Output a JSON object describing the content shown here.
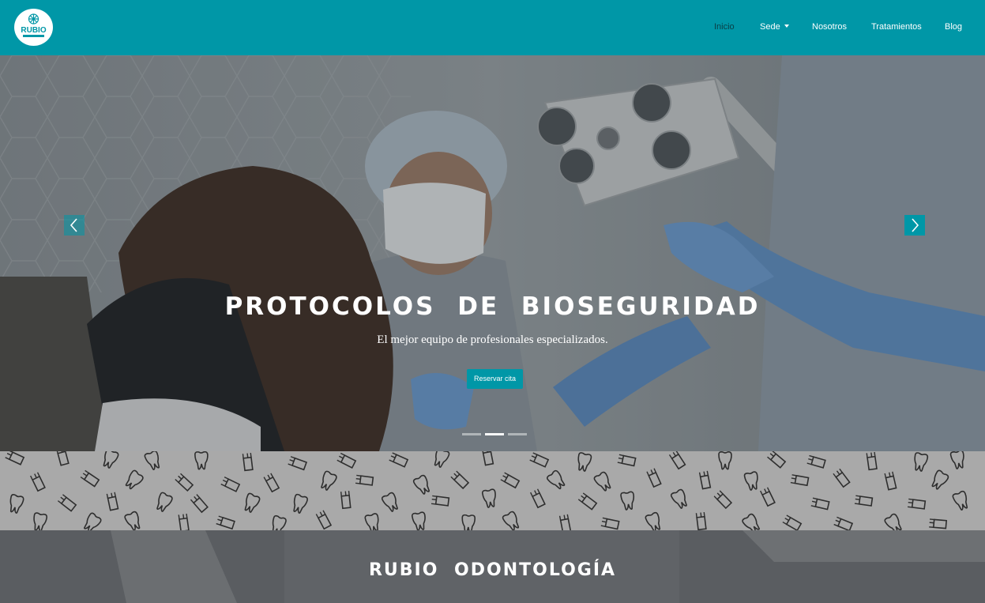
{
  "brand": {
    "logo_text": "RUBIO",
    "logo_icon": "tooth-ornament-icon",
    "color": "#0097a7"
  },
  "nav": {
    "items": [
      {
        "label": "Inicio",
        "active": true
      },
      {
        "label": "Sede",
        "dropdown": true
      },
      {
        "label": "Nosotros"
      },
      {
        "label": "Tratamientos"
      },
      {
        "label": "Blog"
      }
    ]
  },
  "hero": {
    "title": "PROTOCOLOS DE BIOSEGURIDAD",
    "subtitle": "El mejor equipo de profesionales especializados.",
    "cta_label": "Reservar cita",
    "prev_icon": "chevron-left-icon",
    "next_icon": "chevron-right-icon",
    "slides": 3,
    "active_slide": 2
  },
  "pattern": {
    "icon": "tooth-icon"
  },
  "about": {
    "title": "RUBIO ODONTOLOGÍA"
  }
}
